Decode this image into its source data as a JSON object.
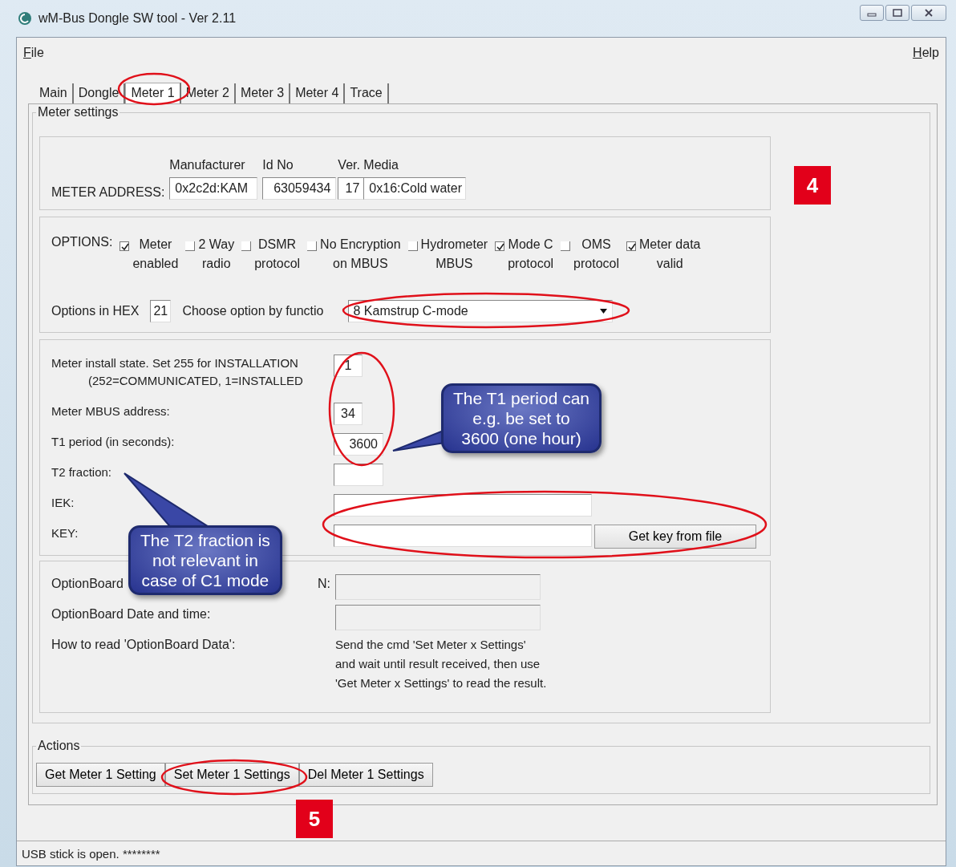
{
  "window": {
    "title": "wM-Bus Dongle SW tool - Ver 2.11"
  },
  "menu": [
    {
      "label": "File"
    },
    {
      "label": "Help"
    }
  ],
  "tabs": [
    {
      "label": "Main",
      "selected": false
    },
    {
      "label": "Dongle",
      "selected": false
    },
    {
      "label": "Meter 1",
      "selected": true
    },
    {
      "label": "Meter 2",
      "selected": false
    },
    {
      "label": "Meter 3",
      "selected": false
    },
    {
      "label": "Meter 4",
      "selected": false
    },
    {
      "label": "Trace",
      "selected": false
    }
  ],
  "meter_settings": {
    "title": "Meter settings",
    "address": {
      "label": "METER ADDRESS:",
      "fields": [
        {
          "heading": "Manufacturer",
          "value": "0x2c2d:KAM"
        },
        {
          "heading": "Id No",
          "value": "63059434"
        },
        {
          "heading": "Ver.",
          "value": "17"
        },
        {
          "heading": "Media",
          "value": "0x16:Cold water"
        }
      ]
    },
    "options": {
      "label": "OPTIONS:",
      "checkboxes": [
        {
          "label": "Meter\nenabled",
          "checked": true
        },
        {
          "label": "2 Way\nradio",
          "checked": false
        },
        {
          "label": "DSMR\nprotocol",
          "checked": false
        },
        {
          "label": "No Encryption\non MBUS",
          "checked": false
        },
        {
          "label": "Hydrometer\nMBUS",
          "checked": false
        },
        {
          "label": "Mode C\nprotocol",
          "checked": true
        },
        {
          "label": "OMS\nprotocol",
          "checked": false
        },
        {
          "label": "Meter data\nvalid",
          "checked": true
        }
      ],
      "hex_label": "Options in HEX",
      "hex_value": "21",
      "function_label": "Choose option by functio",
      "function_value": "8 Kamstrup C-mode"
    },
    "parameters": [
      {
        "label": "Meter install state. Set 255 for INSTALLATION",
        "sublabel": "(252=COMMUNICATED, 1=INSTALLED",
        "value": "1",
        "kind": "short"
      },
      {
        "label": "Meter MBUS address:",
        "value": "34",
        "kind": "short"
      },
      {
        "label": "T1 period (in seconds):",
        "value": "3600",
        "kind": "number"
      },
      {
        "label": "T2 fraction:",
        "kind": "number"
      },
      {
        "label": "IEK:",
        "kind": "wide"
      },
      {
        "label": "KEY:",
        "kind": "wide",
        "button": "Get key from file"
      }
    ],
    "option_board": [
      {
        "label": "OptionBoard",
        "label_end": "N:",
        "kind": "field"
      },
      {
        "label": "OptionBoard Date and time:",
        "kind": "field"
      },
      {
        "label": "How to read 'OptionBoard Data':",
        "kind": "text",
        "text": "Send the cmd 'Set Meter x Settings'\nand wait until result received, then use\n'Get Meter x Settings' to read the result."
      }
    ]
  },
  "actions": {
    "title": "Actions",
    "buttons": [
      "Get Meter 1 Setting",
      "Set Meter 1 Settings",
      "Del Meter 1 Settings"
    ]
  },
  "status_bar": {
    "text": "USB stick is open.  ********"
  },
  "annotations": [
    {
      "kind": "callout",
      "text": "The T1 period can\ne.g. be set to\n3600 (one hour)"
    },
    {
      "kind": "callout",
      "text": "The T2 fraction is\nnot relevant in\ncase of C1 mode"
    },
    {
      "kind": "badge",
      "text": "4"
    },
    {
      "kind": "badge",
      "text": "5"
    }
  ]
}
